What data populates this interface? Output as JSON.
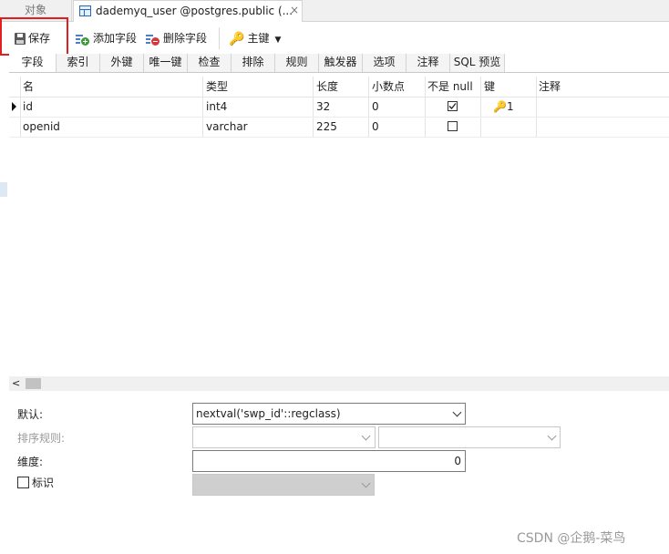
{
  "tabs": {
    "objects_label": "对象",
    "active_title": "dademyq_user @postgres.public (...",
    "close_glyph": "×"
  },
  "toolbar": {
    "save_label": "保存",
    "add_field_label": "添加字段",
    "delete_field_label": "删除字段",
    "primary_key_label": "主键"
  },
  "subtabs": [
    "字段",
    "索引",
    "外键",
    "唯一键",
    "检查",
    "排除",
    "规则",
    "触发器",
    "选项",
    "注释",
    "SQL 预览"
  ],
  "grid": {
    "headers": {
      "name": "名",
      "type": "类型",
      "length": "长度",
      "decimals": "小数点",
      "not_null": "不是 null",
      "key": "键",
      "comment": "注释"
    },
    "rows": [
      {
        "name": "id",
        "type": "int4",
        "length": "32",
        "decimals": "0",
        "not_null": true,
        "key": "1"
      },
      {
        "name": "openid",
        "type": "varchar",
        "length": "225",
        "decimals": "0",
        "not_null": false,
        "key": ""
      }
    ]
  },
  "scroll": {
    "left_arrow": "<"
  },
  "properties": {
    "default_label": "默认:",
    "default_value": "nextval('swp_id'::regclass)",
    "collation_label": "排序规则:",
    "dimension_label": "维度:",
    "dimension_value": "0",
    "identity_label": "标识"
  },
  "watermark": "CSDN @企鹅-菜鸟",
  "colors": {
    "highlight": "#e02020",
    "key_icon": "#d8a21c"
  }
}
